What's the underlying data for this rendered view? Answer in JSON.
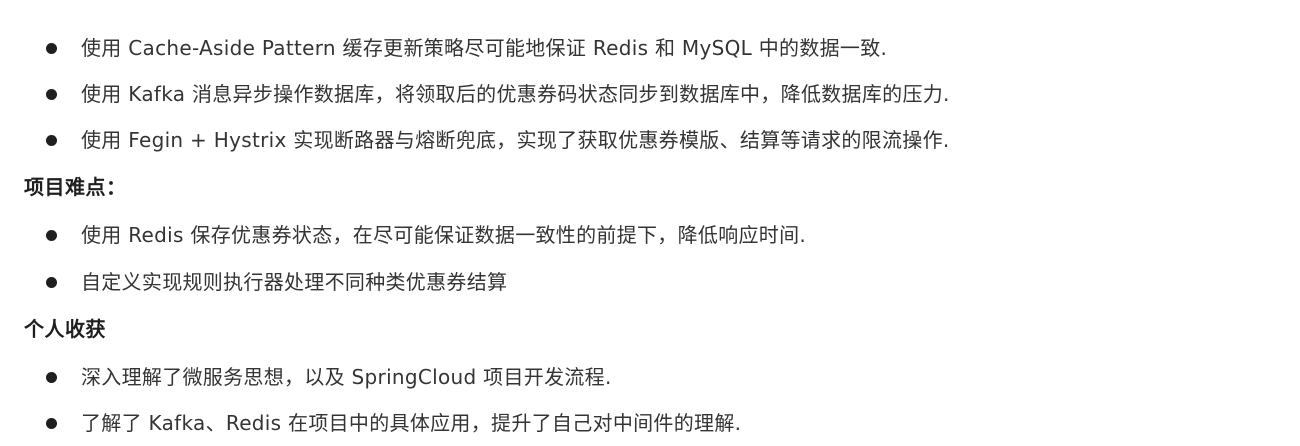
{
  "sections": [
    {
      "heading": "",
      "items": [
        "使用 Cache-Aside Pattern 缓存更新策略尽可能地保证 Redis 和 MySQL 中的数据一致.",
        "使用 Kafka 消息异步操作数据库，将领取后的优惠券码状态同步到数据库中，降低数据库的压力.",
        "使用 Fegin + Hystrix 实现断路器与熔断兜底，实现了获取优惠券模版、结算等请求的限流操作."
      ]
    },
    {
      "heading": "项目难点：",
      "items": [
        "使用 Redis 保存优惠券状态，在尽可能保证数据一致性的前提下，降低响应时间.",
        "自定义实现规则执行器处理不同种类优惠券结算"
      ]
    },
    {
      "heading": "个人收获",
      "items": [
        "深入理解了微服务思想，以及 SpringCloud 项目开发流程.",
        "了解了 Kafka、Redis 在项目中的具体应用，提升了自己对中间件的理解."
      ]
    }
  ]
}
